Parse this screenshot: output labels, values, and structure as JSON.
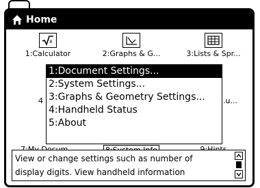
{
  "titlebar": {
    "title": "Home"
  },
  "apps": [
    {
      "number_label": "1:Calculator",
      "icon": "sqrt-icon"
    },
    {
      "number_label": "2:Graphs & G...",
      "icon": "graph-icon"
    },
    {
      "number_label": "3:Lists & Spr...",
      "icon": "spreadsheet-icon"
    },
    {
      "number_label": "4",
      "icon": ""
    },
    {
      "number_label": "...u...",
      "icon": ""
    },
    {
      "number_label": "7:My Docum...",
      "icon": ""
    },
    {
      "number_label": "8:System Info",
      "icon": ""
    },
    {
      "number_label": "9:Hints",
      "icon": ""
    }
  ],
  "dropdown": {
    "items": [
      "1:Document Settings...",
      "2:System Settings...",
      "3:Graphs & Geometry Settings...",
      "4:Handheld Status",
      "5:About"
    ],
    "selected_index": 0
  },
  "info": {
    "line1": "View or change settings such as number of",
    "line2": "display digits.  View handheld information"
  }
}
